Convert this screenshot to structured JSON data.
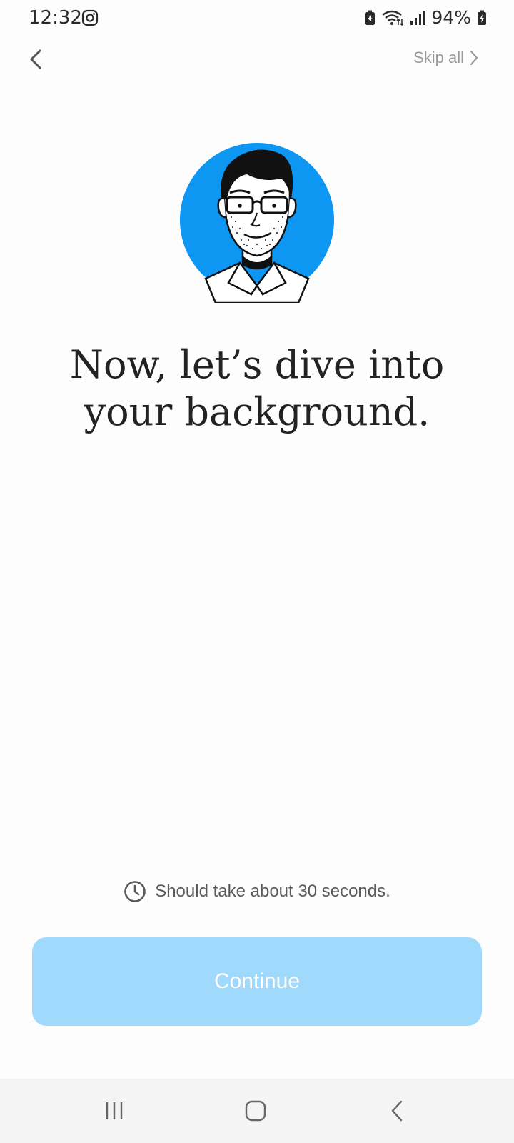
{
  "status_bar": {
    "time": "12:32",
    "battery_percent": "94%",
    "icons": [
      "instagram-icon",
      "battery-saver-icon",
      "wifi-icon",
      "signal-icon",
      "battery-icon"
    ]
  },
  "top_nav": {
    "back_icon": "chevron-left-icon",
    "skip_label": "Skip all",
    "skip_icon": "chevron-right-icon"
  },
  "avatar": {
    "icon": "person-illustration",
    "background_color": "#0d96f2"
  },
  "headline": "Now, let’s dive into your background.",
  "duration_note": {
    "icon": "clock-icon",
    "text": "Should take about 30 seconds."
  },
  "continue_button": {
    "label": "Continue",
    "color": "#9fd9fc"
  },
  "system_nav": {
    "recents_icon": "recents-icon",
    "home_icon": "home-icon",
    "back_icon": "back-icon"
  }
}
